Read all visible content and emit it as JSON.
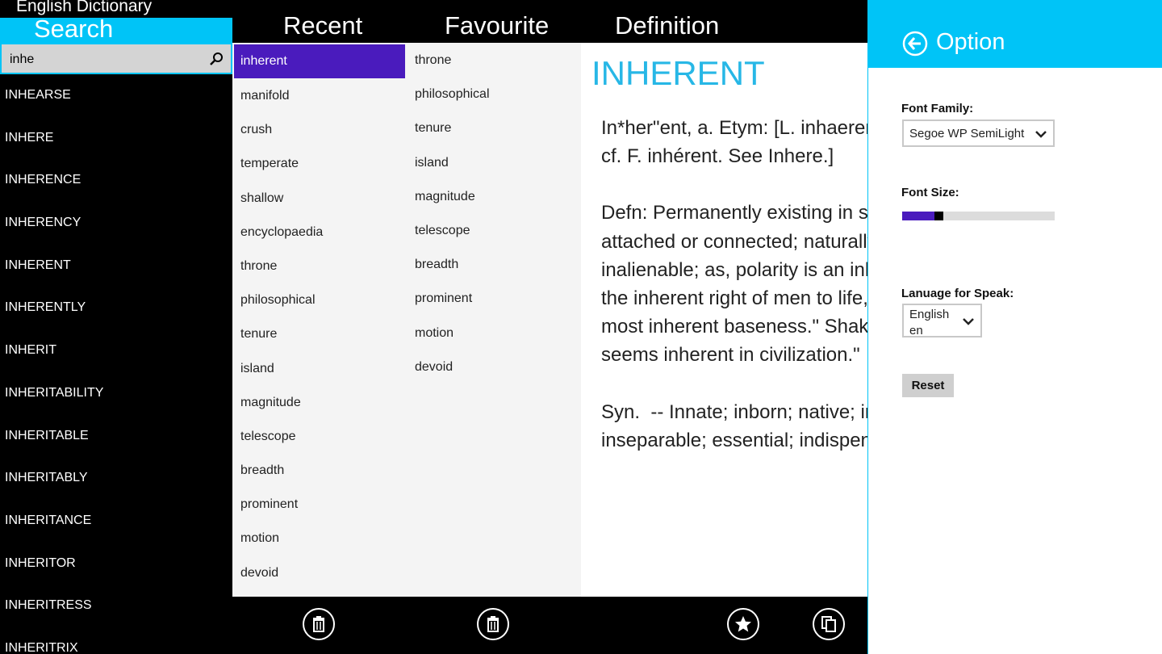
{
  "app": {
    "title": "English Dictionary"
  },
  "search": {
    "header": "Search",
    "value": "inhe",
    "suggestions": [
      "INHEARSE",
      "INHERE",
      "INHERENCE",
      "INHERENCY",
      "INHERENT",
      "INHERENTLY",
      "INHERIT",
      "INHERITABILITY",
      "INHERITABLE",
      "INHERITABLY",
      "INHERITANCE",
      "INHERITOR",
      "INHERITRESS",
      "INHERITRIX"
    ]
  },
  "columns": {
    "recent": "Recent",
    "favourite": "Favourite",
    "definition": "Definition"
  },
  "recent": {
    "selected_index": 0,
    "items": [
      "inherent",
      "manifold",
      "crush",
      "temperate",
      "shallow",
      "encyclopaedia",
      "throne",
      "philosophical",
      "tenure",
      "island",
      "magnitude",
      "telescope",
      "breadth",
      "prominent",
      "motion",
      "devoid"
    ]
  },
  "favourite": {
    "items": [
      "throne",
      "philosophical",
      "tenure",
      "island",
      "magnitude",
      "telescope",
      "breadth",
      "prominent",
      "motion",
      "devoid"
    ]
  },
  "definition": {
    "word": "INHERENT",
    "paragraphs": [
      "In*her\"ent, a. Etym: [L. inhaerens, -entis, p. pr.\ncf. F. inhérent. See Inhere.]",
      "Defn: Permanently existing in something;\nattached or connected; naturally pertaining to;\ninalienable; as, polarity is an inherent quality;\nthe inherent right of men to life, liberty,\nmost inherent baseness.\" Shak. \"The power\nseems inherent in civilization.\"",
      "Syn.  -- Innate; inborn; native; inbred; inward;\ninseparable; essential; indispensable."
    ]
  },
  "bottom_bar": {
    "icons": [
      "trash-icon",
      "trash-icon",
      "star-icon",
      "copy-icon"
    ]
  },
  "options": {
    "title": "Option",
    "font_family_label": "Font Family:",
    "font_family_value": "Segoe WP SemiLight",
    "font_size_label": "Font Size:",
    "font_size_fraction": 0.27,
    "language_label": "Lanuage for Speak:",
    "language_value": "English\nen",
    "reset_label": "Reset"
  },
  "colors": {
    "accent": "#00c4f7",
    "selection": "#4a1bbd",
    "definition_word": "#27b7e6"
  }
}
